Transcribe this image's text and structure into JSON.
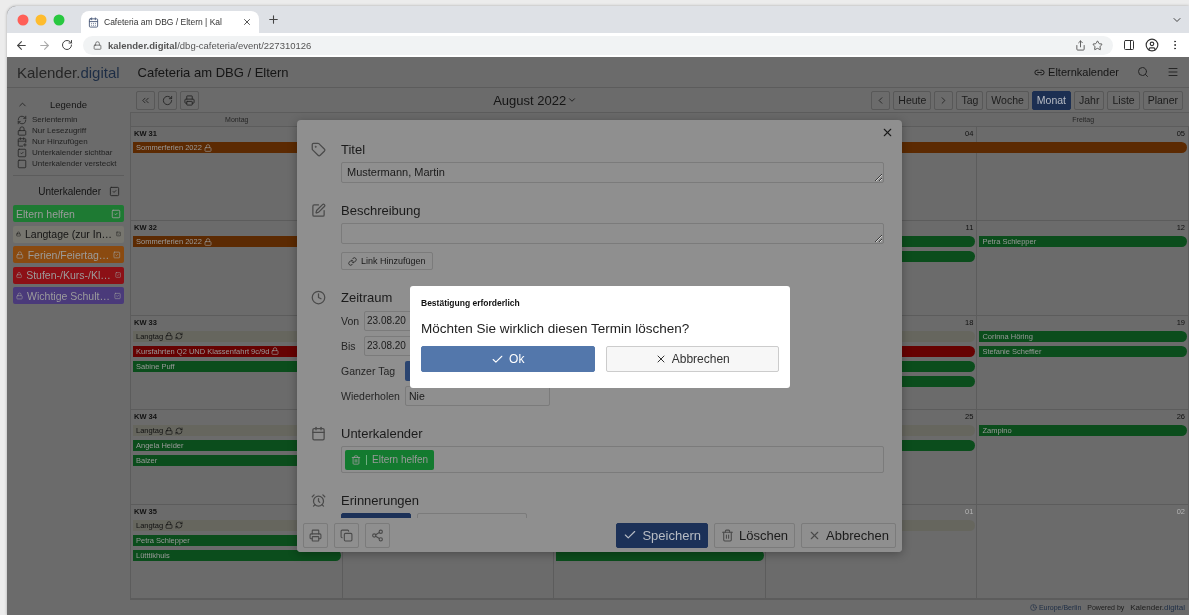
{
  "browser": {
    "tab_title": "Cafeteria am DBG / Eltern | Kal",
    "url": "**kalender.digital**/dbg-cafeteria/event/227310126"
  },
  "header": {
    "logo": {
      "text": "Kalender.",
      "accent": "digital"
    },
    "title": "Cafeteria am DBG / Eltern",
    "link": "Elternkalender"
  },
  "sidebar": {
    "legend_title": "Legende",
    "legend": [
      {
        "kind": "recurring",
        "label": "Serientermin"
      },
      {
        "kind": "readonly",
        "label": "Nur Lesezugriff"
      },
      {
        "kind": "add_only",
        "label": "Nur Hinzufügen"
      },
      {
        "kind": "visible",
        "label": "Unterkalender sichtbar"
      },
      {
        "kind": "hidden",
        "label": "Unterkalender versteckt"
      }
    ],
    "subcalendars_title": "Unterkalender",
    "subcalendars_checked": true,
    "calendars": [
      {
        "name": "Eltern helfen",
        "color": "#1e7a33",
        "locked": false,
        "checked": true
      },
      {
        "name": "Langtage (zur In…",
        "color": "#77766f",
        "locked": true,
        "checked": true
      },
      {
        "name": "Ferien/Feiertag…",
        "color": "#8a4a10",
        "locked": true,
        "checked": true
      },
      {
        "name": "Stufen-/Kurs-/Kl…",
        "color": "#8c1016",
        "locked": true,
        "checked": true
      },
      {
        "name": "Wichtige Schult…",
        "color": "#4a3a7a",
        "locked": true,
        "checked": true
      }
    ]
  },
  "toolbar": {
    "month": "August 2022",
    "today": "Heute",
    "views": [
      {
        "label": "Tag",
        "selected": false
      },
      {
        "label": "Woche",
        "selected": false
      },
      {
        "label": "Monat",
        "selected": true
      },
      {
        "label": "Jahr",
        "selected": false
      },
      {
        "label": "Liste",
        "selected": false
      },
      {
        "label": "Planer",
        "selected": false
      }
    ]
  },
  "calendar": {
    "weekdays": {
      "first": "Montag",
      "last": "Freitag"
    },
    "weeks": [
      {
        "kw": "KW 31",
        "day_numbers": [
          {
            "text": "04",
            "muted": false
          },
          {
            "text": "05",
            "muted": false
          }
        ],
        "lanes": [
          {
            "segments": [
              {
                "kind": "bar",
                "title": "Sommerferien 2022",
                "color": "#5c2a02",
                "locked": true,
                "recurring": false
              },
              {
                "kind": "continued"
              },
              {
                "kind": "continued"
              },
              {
                "kind": "continued"
              },
              {
                "kind": "continued"
              }
            ]
          }
        ]
      },
      {
        "kw": "KW 32",
        "day_numbers": [
          {
            "text": "11",
            "muted": false
          },
          {
            "text": "12",
            "muted": false
          }
        ],
        "lanes": [
          {
            "segments": [
              {
                "kind": "bar",
                "title": "Sommerferien 2022",
                "color": "#5c2a02",
                "locked": true,
                "recurring": false
              },
              {
                "kind": "empty"
              },
              {
                "kind": "bar",
                "color": "#0b4d1c"
              },
              {
                "kind": "continued"
              },
              {
                "kind": "bar",
                "title": "Petra Schlepper",
                "color": "#0b4d1c",
                "locked": false,
                "recurring": false
              }
            ]
          },
          {
            "segments": [
              {
                "kind": "empty"
              },
              {
                "kind": "empty"
              },
              {
                "kind": "bar",
                "color": "#0b4d1c"
              },
              {
                "kind": "continued"
              },
              {
                "kind": "empty"
              }
            ]
          }
        ]
      },
      {
        "kw": "KW 33",
        "day_numbers": [
          {
            "text": "18",
            "muted": false
          },
          {
            "text": "19",
            "muted": false
          }
        ],
        "lanes": [
          {
            "segments": [
              {
                "kind": "bar",
                "title": "Langtag",
                "color": "#66665e",
                "locked": true,
                "recurring": true
              },
              {
                "kind": "continued"
              },
              {
                "kind": "continued"
              },
              {
                "kind": "continued"
              },
              {
                "kind": "bar",
                "title": "Corinna Höring",
                "color": "#0b4d1c",
                "locked": false,
                "recurring": false
              }
            ]
          },
          {
            "segments": [
              {
                "kind": "bar",
                "title": "Kursfahrten Q2 UND Klassenfahrt 9c/9d",
                "color": "#660202",
                "locked": true,
                "recurring": false
              },
              {
                "kind": "continued"
              },
              {
                "kind": "continued"
              },
              {
                "kind": "continued"
              },
              {
                "kind": "bar",
                "title": "Stefanie Scheffler",
                "color": "#0b4d1c",
                "locked": false,
                "recurring": false
              }
            ]
          },
          {
            "segments": [
              {
                "kind": "bar",
                "title": "Sabine Puff",
                "color": "#0b4d1c",
                "locked": false,
                "recurring": false
              },
              {
                "kind": "continued"
              },
              {
                "kind": "continued"
              },
              {
                "kind": "continued"
              },
              {
                "kind": "empty"
              }
            ]
          },
          {
            "segments": [
              {
                "kind": "empty"
              },
              {
                "kind": "empty"
              },
              {
                "kind": "empty"
              },
              {
                "kind": "bar",
                "color": "#0b4d1c"
              },
              {
                "kind": "empty"
              }
            ]
          }
        ]
      },
      {
        "kw": "KW 34",
        "day_numbers": [
          {
            "text": "25",
            "muted": false
          },
          {
            "text": "26",
            "muted": false
          }
        ],
        "lanes": [
          {
            "segments": [
              {
                "kind": "bar",
                "title": "Langtag",
                "color": "#66665e",
                "locked": true,
                "recurring": true
              },
              {
                "kind": "continued"
              },
              {
                "kind": "continued"
              },
              {
                "kind": "continued"
              },
              {
                "kind": "bar",
                "title": "Zampino",
                "color": "#0b4d1c",
                "locked": false,
                "recurring": false
              }
            ]
          },
          {
            "segments": [
              {
                "kind": "bar",
                "title": "Angela Heider",
                "color": "#0b4d1c",
                "locked": false,
                "recurring": false
              },
              {
                "kind": "continued"
              },
              {
                "kind": "continued"
              },
              {
                "kind": "continued"
              },
              {
                "kind": "empty"
              }
            ]
          },
          {
            "segments": [
              {
                "kind": "bar",
                "title": "Balzer",
                "color": "#0b4d1c",
                "locked": false,
                "recurring": false
              },
              {
                "kind": "continued"
              },
              {
                "kind": "empty"
              },
              {
                "kind": "empty"
              },
              {
                "kind": "empty"
              }
            ]
          }
        ]
      },
      {
        "kw": "KW 35",
        "day_numbers": [
          {
            "text": "01",
            "muted": true
          },
          {
            "text": "02",
            "muted": true
          }
        ],
        "lanes": [
          {
            "segments": [
              {
                "kind": "bar",
                "title": "Langtag",
                "color": "#66665e",
                "locked": true,
                "recurring": true
              },
              {
                "kind": "continued"
              },
              {
                "kind": "continued"
              },
              {
                "kind": "continued"
              },
              {
                "kind": "empty"
              }
            ]
          },
          {
            "segments": [
              {
                "kind": "bar",
                "title": "Petra Schlepper",
                "color": "#0b4d1c",
                "locked": false,
                "recurring": false
              },
              {
                "kind": "empty"
              },
              {
                "kind": "empty"
              },
              {
                "kind": "empty"
              },
              {
                "kind": "empty"
              }
            ]
          },
          {
            "segments": [
              {
                "kind": "bar",
                "title": "Lütttikhuis",
                "color": "#0b4d1c",
                "locked": false,
                "recurring": false
              },
              {
                "kind": "empty"
              },
              {
                "kind": "bar",
                "color": "#0b4d1c"
              },
              {
                "kind": "empty"
              },
              {
                "kind": "empty"
              }
            ]
          }
        ]
      }
    ]
  },
  "event_dialog": {
    "title_label": "Titel",
    "title_value": "Mustermann, Martin",
    "description_label": "Beschreibung",
    "link_button": "Link Hinzufügen",
    "period_label": "Zeitraum",
    "from_label": "Von",
    "from_value": "23.08.20",
    "to_label": "Bis",
    "to_value": "23.08.20",
    "all_day_label": "Ganzer Tag",
    "all_day": true,
    "repeat_label": "Wiederholen",
    "repeat_value": "Nie",
    "subcalendar_label": "Unterkalender",
    "subcalendar_chip": {
      "name": "Eltern helfen",
      "color": "#137a2f"
    },
    "reminders_label": "Erinnerungen",
    "save": "Speichern",
    "delete": "Löschen",
    "cancel": "Abbrechen"
  },
  "confirm_dialog": {
    "title": "Bestätigung erforderlich",
    "message": "Möchten Sie wirklich diesen Termin löschen?",
    "ok": "Ok",
    "cancel": "Abbrechen"
  },
  "footer": {
    "timezone": "Europe/Berlin",
    "powered": "Powered by",
    "brand": {
      "text": "Kalender.",
      "accent": "digital"
    }
  }
}
